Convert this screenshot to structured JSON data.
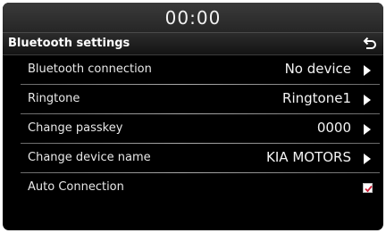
{
  "status_bar": {
    "clock": "00:00"
  },
  "header": {
    "title": "Bluetooth settings",
    "back_icon": "back-arrow-icon"
  },
  "settings": [
    {
      "label": "Bluetooth connection",
      "value": "No device",
      "control": "arrow"
    },
    {
      "label": "Ringtone",
      "value": "Ringtone1",
      "control": "arrow"
    },
    {
      "label": "Change passkey",
      "value": "0000",
      "control": "arrow"
    },
    {
      "label": "Change device name",
      "value": "KIA MOTORS",
      "control": "arrow"
    },
    {
      "label": "Auto Connection",
      "checked": true,
      "control": "checkbox"
    }
  ],
  "colors": {
    "background": "#000000",
    "text": "#ffffff",
    "checkmark": "#d0203a"
  }
}
